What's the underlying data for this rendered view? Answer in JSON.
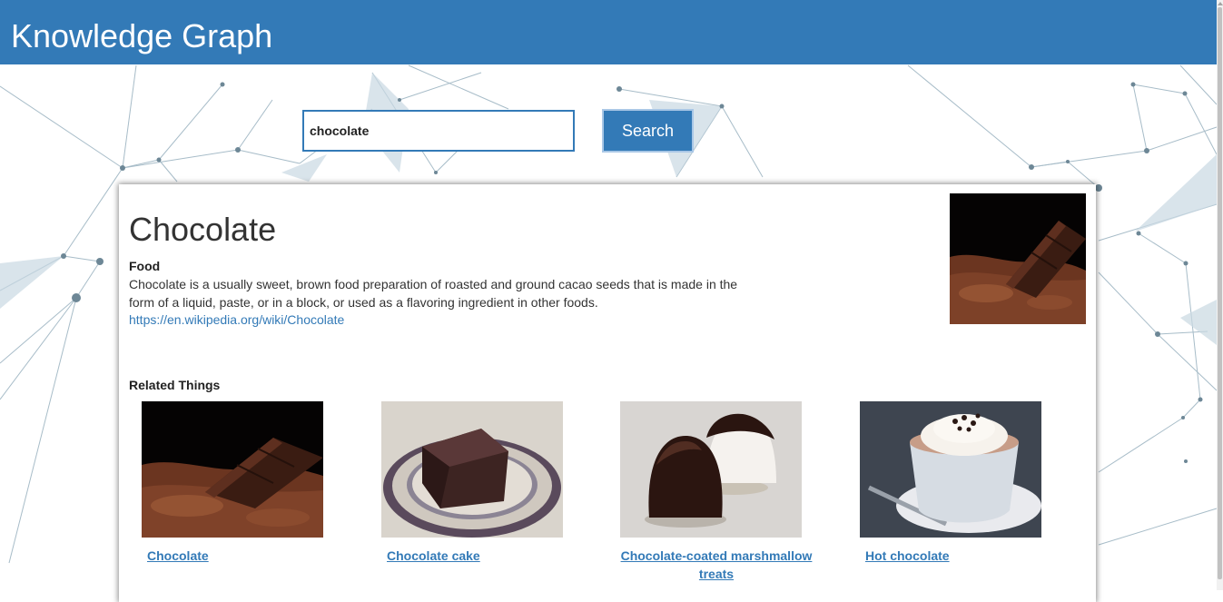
{
  "header": {
    "title": "Knowledge Graph"
  },
  "search": {
    "value": "chocolate",
    "button_label": "Search"
  },
  "entity": {
    "name": "Chocolate",
    "type": "Food",
    "description": "Chocolate is a usually sweet, brown food preparation of roasted and ground cacao seeds that is made in the form of a liquid, paste, or in a block, or used as a flavoring ingredient in other foods.",
    "link": "https://en.wikipedia.org/wiki/Chocolate"
  },
  "related": {
    "heading": "Related Things",
    "items": [
      {
        "label": "Chocolate"
      },
      {
        "label": "Chocolate cake"
      },
      {
        "label": "Chocolate-coated marshmallow treats"
      },
      {
        "label": "Hot chocolate"
      }
    ]
  },
  "colors": {
    "header": "#337ab7",
    "link": "#337ab7",
    "network_lines": "#5b7f93"
  }
}
